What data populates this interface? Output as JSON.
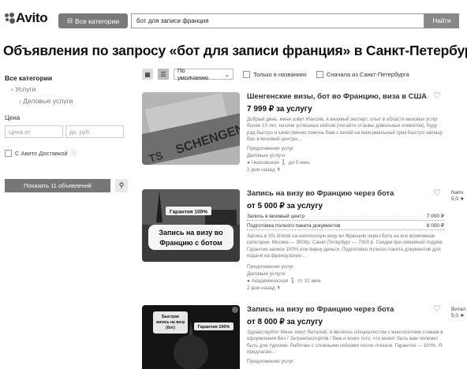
{
  "header": {
    "logo_text": "Avito",
    "categories_button": "Все категории",
    "search_value": "бот для записи франция",
    "search_button": "Найти"
  },
  "page_title": "Объявления по запросу «бот для записи франция» в Санкт-Петербург",
  "sidebar": {
    "all_categories": "Все категории",
    "services": "Услуги",
    "business_services": "Деловые услуги",
    "price_label": "Цена",
    "price_from": "Цена от",
    "price_to": "до, руб.",
    "avito_delivery": "С Авито Доставкой",
    "show_button": "Показать 11 объявлений"
  },
  "toolbar": {
    "sort_value": "По умолчанию",
    "only_titles": "Только в названиях",
    "spb_first": "Сначала из Санкт-Петербурга"
  },
  "listings": [
    {
      "title": "Шенгенские визы, бот во Францию, виза в США",
      "price": "7 999 ₽ за услугу",
      "desc": "Добрый день, меня зовут Максим, я визовый эксперт, опыт в области визовых услуг более 10 лет, тысячи успешных кейсов (читайте отзывы довольных клиентов), буду рад быстро и качественно помочь Вам с визой на максимальный срок Быстро запишу Вас в визовый центры...",
      "category": "Предложение услуг",
      "subcategory": "Деловые услуги",
      "location": "Чкаловская",
      "distance": "до 5 мин.",
      "time": "2 дня назад"
    },
    {
      "title": "Запись на визу во Францию через бота",
      "price": "от 5 000 ₽ за услугу",
      "thumb_badge": "Гарантия 100%",
      "thumb_caption": "Запись на визу во Францию с ботом",
      "packages": [
        {
          "name": "Запись в визовый центр",
          "price": "7 000 ₽"
        },
        {
          "name": "Подготовка полного пакета документов",
          "price": "8 000 ₽"
        }
      ],
      "desc": "Запись в Vfs Global на шенгенскую визу во Францию через бота на все возможные категории. Москва — 9000р. Санкт-Петербург — 7000 р. Скидки при семейной подаче. Гарантия записи 100% или верну деньги. Подготовка полного пакета документов для подачи на французскую...",
      "category": "Предложение услуг",
      "subcategory": "Деловые услуги",
      "location": "Академическая",
      "distance": "от 31 мин.",
      "time": "2 дня назад",
      "seller_name": "Nami",
      "seller_rating": "5,0"
    },
    {
      "title": "Запись на визу во Францию через бота",
      "price": "от 8 000 ₽ за услугу",
      "thumb_badges": [
        "Быстрая запись на визу",
        "Гарантия 100%"
      ],
      "desc": "Здравствуйте! Меня зовут Виталий, я являюсь специалистом с многолетним стажем в оформлении Виз / Загранпаспортов / Внж и всего того, что может быть вам полезно быть для туризма. Работаю с сложными кейсами после отказов. Гарантия — 100%. Я предлагаю...",
      "category": "Предложение услуг",
      "seller_name": "Витал",
      "seller_rating": "5,0"
    }
  ]
}
